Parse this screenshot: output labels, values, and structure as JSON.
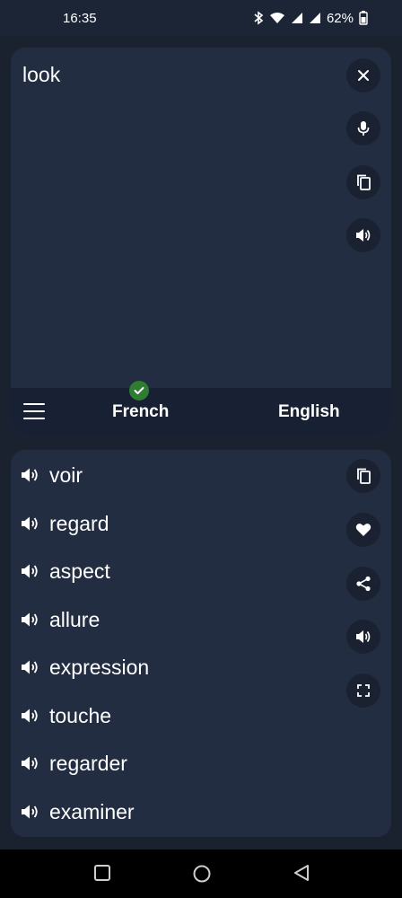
{
  "status_bar": {
    "time": "16:35",
    "battery": "62%",
    "icons": [
      "bluetooth-icon",
      "wifi-icon",
      "signal-icon",
      "signal-icon",
      "battery-icon"
    ]
  },
  "input": {
    "text": "look",
    "actions": [
      "close-icon",
      "microphone-icon",
      "copy-icon",
      "speaker-icon"
    ]
  },
  "languages": {
    "menu_icon": "menu-icon",
    "source": "French",
    "target": "English",
    "source_verified_icon": "check-icon"
  },
  "results": {
    "items": [
      {
        "label": "voir"
      },
      {
        "label": "regard"
      },
      {
        "label": "aspect"
      },
      {
        "label": "allure"
      },
      {
        "label": "expression"
      },
      {
        "label": "touche"
      },
      {
        "label": "regarder"
      },
      {
        "label": "examiner"
      }
    ],
    "actions": [
      "copy-icon",
      "heart-icon",
      "share-icon",
      "speaker-icon",
      "fullscreen-icon"
    ]
  },
  "nav_bar": {
    "buttons": [
      "recents-icon",
      "home-icon",
      "back-icon"
    ]
  },
  "colors": {
    "background": "#1a2230",
    "card": "#222d42",
    "lang_bar": "#182134",
    "fab": "#1a2232",
    "check": "#2e7d32"
  }
}
